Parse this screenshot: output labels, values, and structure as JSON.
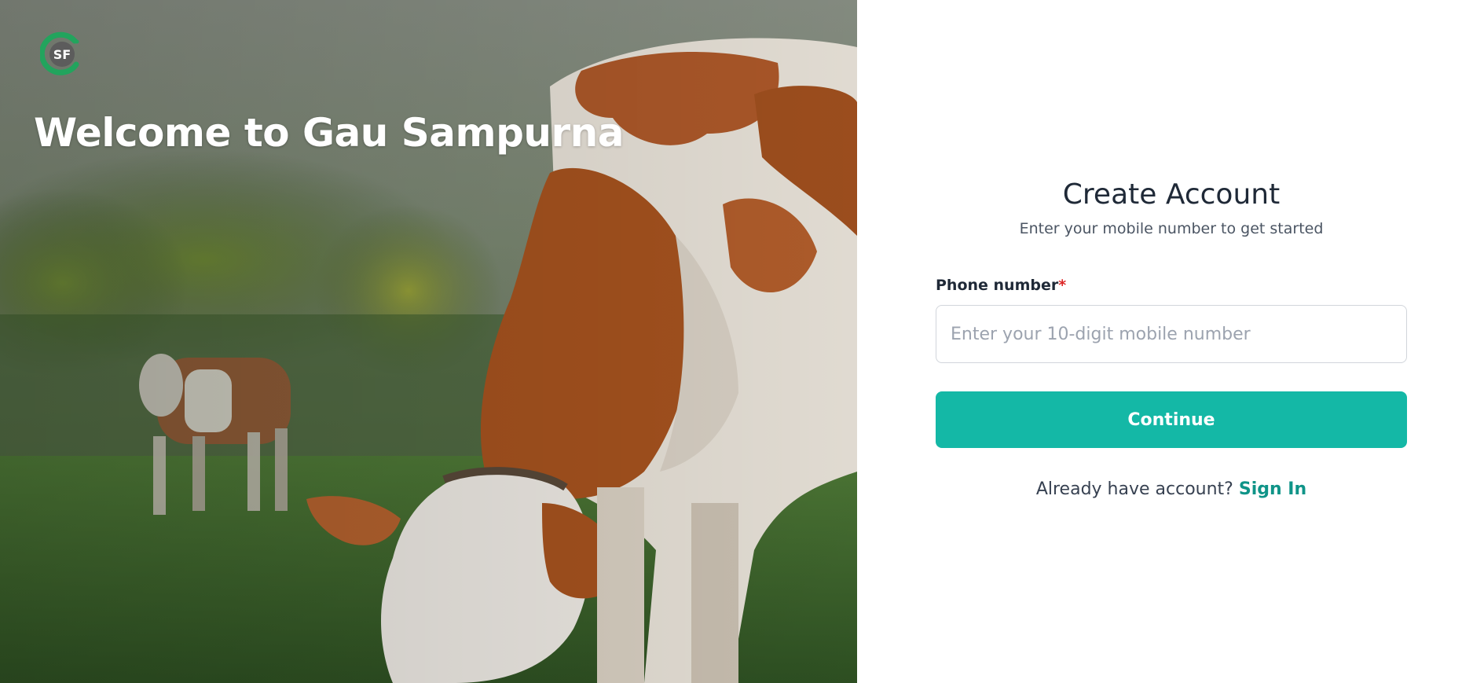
{
  "hero": {
    "title": "Welcome to Gau Sampurna",
    "logo_text": "SF",
    "logo_icon": "sf-logo-icon",
    "image": "cow-grazing-photo"
  },
  "form": {
    "title": "Create Account",
    "subtitle": "Enter your mobile number to get started",
    "phone_label": "Phone number",
    "required_mark": "*",
    "phone_value": "",
    "phone_placeholder": "Enter your 10-digit mobile number",
    "continue_label": "Continue",
    "signin_prompt": "Already have account?",
    "signin_link": "Sign In"
  },
  "colors": {
    "accent": "#14b8a6",
    "link": "#0f9488",
    "required": "#dc2626",
    "logo_green": "#22a45d"
  }
}
